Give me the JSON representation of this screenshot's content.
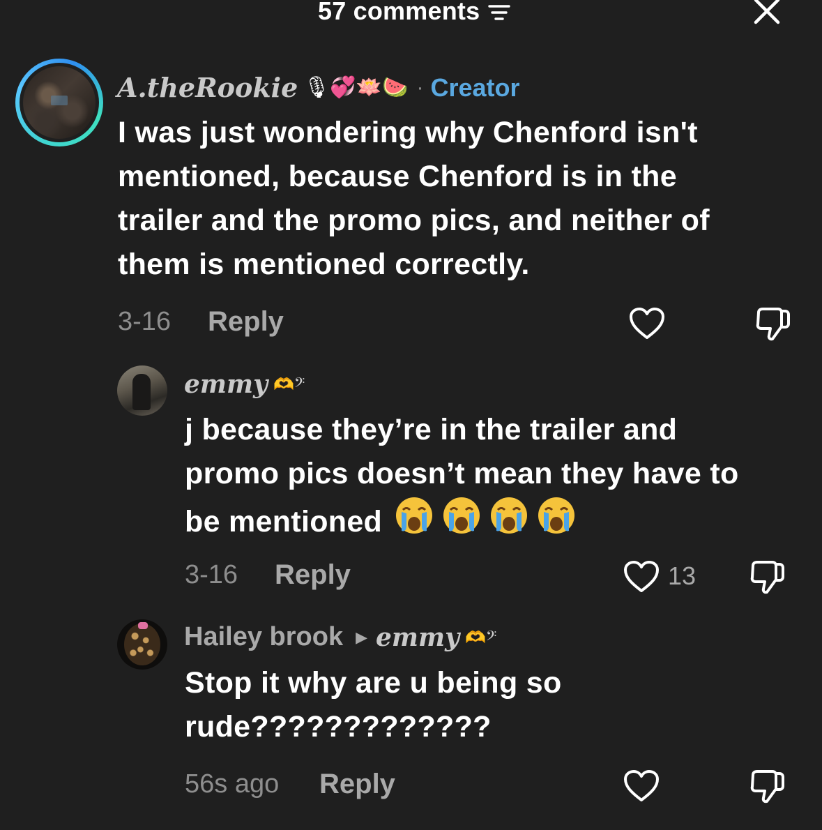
{
  "header": {
    "title": "57 comments"
  },
  "comments": [
    {
      "username": "A.theRookie",
      "username_emojis": "🎙💞🪷🍉",
      "creator_label": "Creator",
      "separator": "·",
      "text_lines": [
        "I was just wondering why Chenford isn't",
        "mentioned, because Chenford is in the",
        "trailer and the promo pics, and neither of",
        "them is mentioned correctly."
      ],
      "date": "3-16",
      "reply_label": "Reply"
    },
    {
      "username": "emmy",
      "username_emojis": "🫶𝄢",
      "text_lines": [
        "j because they’re in the trailer and",
        "promo pics doesn’t mean they have to",
        "be mentioned"
      ],
      "date": "3-16",
      "reply_label": "Reply",
      "likes": "13"
    },
    {
      "username": "Hailey brook",
      "reply_to": "emmy",
      "reply_to_emojis": "🫶𝄢",
      "text_lines": [
        "Stop it why are u being so",
        "rude?????????????"
      ],
      "date": "56s ago",
      "reply_label": "Reply"
    }
  ],
  "colors": {
    "background": "#1f1f1f",
    "creator_accent": "#5aa8e0",
    "muted_text": "#8e8e8e",
    "text": "#ffffff"
  }
}
